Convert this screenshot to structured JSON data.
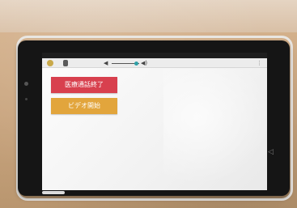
{
  "status_bar": {
    "time": "",
    "battery": ""
  },
  "app_bar": {
    "mode_label": "",
    "volume": 0.9
  },
  "main": {
    "end_call_label": "医療通話終了",
    "video_start_label": "ビデオ開始"
  },
  "colors": {
    "end_call": "#d8404e",
    "video_start": "#e2a53c",
    "volume_thumb": "#2f9fa6"
  },
  "icons": [
    "app-logo-icon",
    "volume-low-icon",
    "volume-high-icon",
    "menu-icon",
    "back-icon"
  ]
}
